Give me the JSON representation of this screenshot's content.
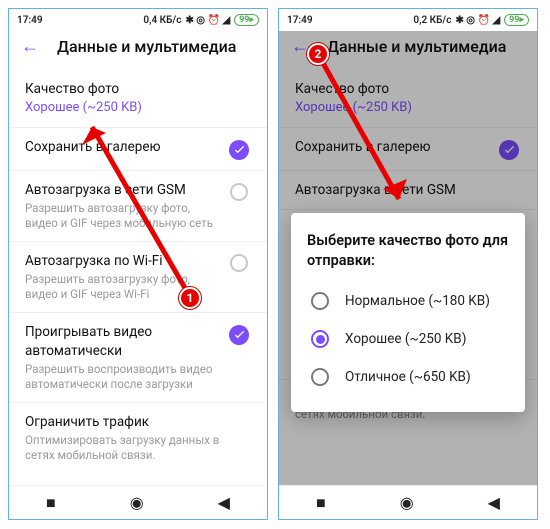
{
  "status": {
    "time": "17:49",
    "speed_a": "0,4 КБ/с",
    "speed_b": "0,2 КБ/с",
    "battery": "99"
  },
  "screenA": {
    "title": "Данные и мультимедиа",
    "rows": [
      {
        "label": "Качество фото",
        "sub": "Хорошее (~250 KB)"
      },
      {
        "label": "Сохранить в галерею"
      },
      {
        "label": "Автозагрузка в сети GSM",
        "sub": "Разрешить автозагрузку фото, видео и GIF через мобильную сеть"
      },
      {
        "label": "Автозагрузка по Wi-Fi",
        "sub": "Разрешить автозагрузку фото, видео и GIF через Wi-Fi"
      },
      {
        "label": "Проигрывать видео автоматически",
        "sub": "Разрешить воспроизводить видео автоматически после загрузки"
      },
      {
        "label": "Ограничить трафик",
        "sub": "Оптимизировать загрузку данных в сетях мобильной связи."
      }
    ]
  },
  "screenB": {
    "title": "Данные и мультимедиа",
    "photo_label": "Качество фото",
    "photo_sub": "Хорошее (~250 KB)",
    "save_label": "Сохранить в галерею",
    "gsm_label": "Автозагрузка в сети GSM",
    "limit_sub": "Оптимизировать загрузку данных в сетях мобильной связи."
  },
  "dialog": {
    "title": "Выберите качество фото для отправки:",
    "options": [
      {
        "label": "Нормальное (~180 KB)"
      },
      {
        "label": "Хорошее (~250 KB)"
      },
      {
        "label": "Отличное (~650 KB)"
      }
    ]
  },
  "annot": {
    "one": "1",
    "two": "2"
  }
}
